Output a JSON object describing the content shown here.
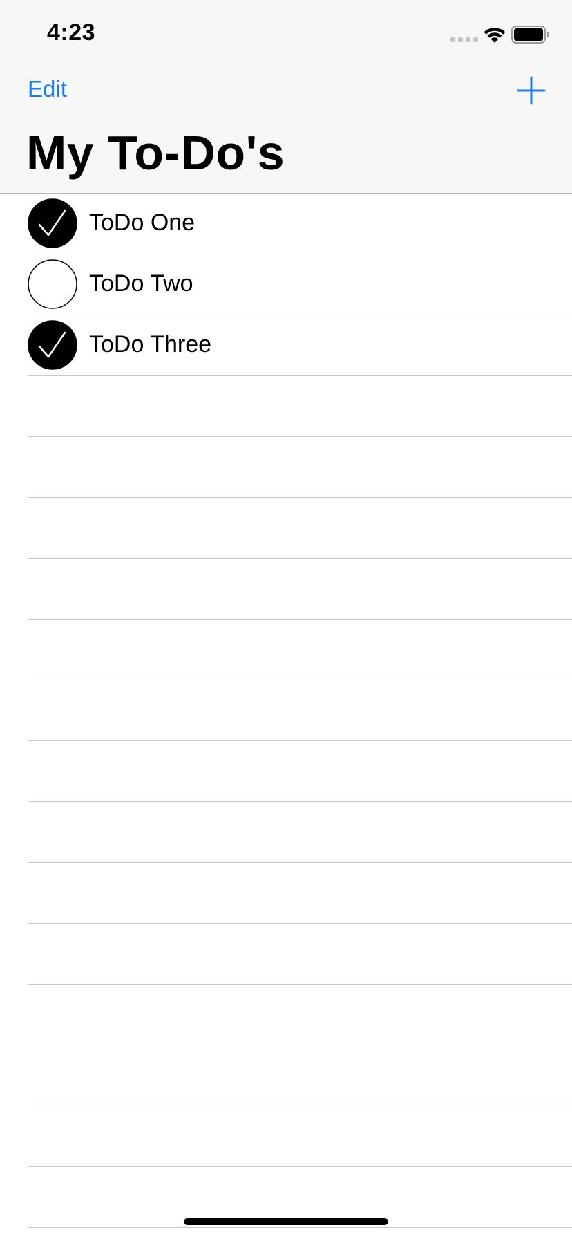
{
  "status_bar": {
    "time": "4:23",
    "icons": [
      "cellular-signal-icon",
      "wifi-icon",
      "battery-icon"
    ]
  },
  "nav": {
    "edit_label": "Edit",
    "add_icon": "plus-icon",
    "title": "My To-Do's"
  },
  "todos": [
    {
      "label": "ToDo One",
      "done": true
    },
    {
      "label": "ToDo Two",
      "done": false
    },
    {
      "label": "ToDo Three",
      "done": true
    }
  ],
  "empty_rows": 14,
  "colors": {
    "accent": "#1a7cf5",
    "header_bg": "#f7f7f7",
    "separator": "#c8c7cc",
    "check_fill": "#000000"
  }
}
